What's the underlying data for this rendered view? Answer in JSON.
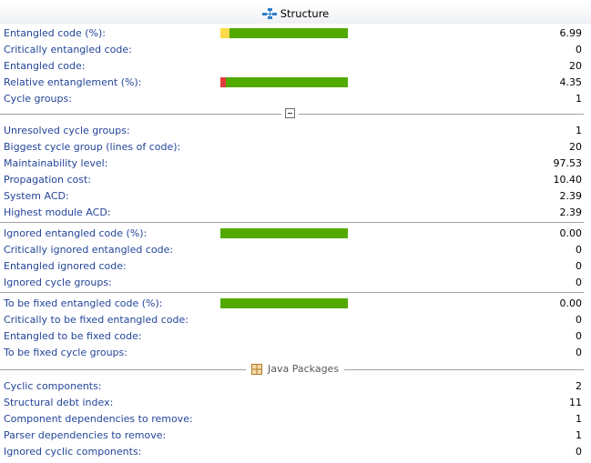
{
  "header": {
    "title": "Structure",
    "icon": "structure-icon"
  },
  "section2": {
    "title": "Java Packages",
    "icon": "java-packages-icon"
  },
  "colors": {
    "bar_green": "#52a900",
    "bar_yellow": "#fdd94c",
    "bar_red": "#e33b3b",
    "label": "#23459a"
  },
  "group1": [
    {
      "label": "Entangled code (%):",
      "value": "6.99",
      "bar": true,
      "seg_color": "#fdd94c",
      "seg_fraction": 0.07
    },
    {
      "label": "Critically entangled code:",
      "value": "0"
    },
    {
      "label": "Entangled code:",
      "value": "20"
    },
    {
      "label": "Relative entanglement (%):",
      "value": "4.35",
      "bar": true,
      "seg_color": "#e33b3b",
      "seg_fraction": 0.0435
    },
    {
      "label": "Cycle groups:",
      "value": "1"
    }
  ],
  "group2": [
    {
      "label": "Unresolved cycle groups:",
      "value": "1"
    },
    {
      "label": "Biggest cycle group (lines of code):",
      "value": "20"
    },
    {
      "label": "Maintainability level:",
      "value": "97.53"
    },
    {
      "label": "Propagation cost:",
      "value": "10.40"
    },
    {
      "label": "System ACD:",
      "value": "2.39"
    },
    {
      "label": "Highest module ACD:",
      "value": "2.39"
    }
  ],
  "group3": [
    {
      "label": "Ignored entangled code (%):",
      "value": "0.00",
      "bar": true
    },
    {
      "label": "Critically ignored entangled code:",
      "value": "0"
    },
    {
      "label": "Entangled ignored code:",
      "value": "0"
    },
    {
      "label": "Ignored cycle groups:",
      "value": "0"
    }
  ],
  "group4": [
    {
      "label": "To be fixed entangled code (%):",
      "value": "0.00",
      "bar": true
    },
    {
      "label": "Critically to be fixed entangled code:",
      "value": "0"
    },
    {
      "label": "Entangled to be fixed code:",
      "value": "0"
    },
    {
      "label": "To be fixed cycle groups:",
      "value": "0"
    }
  ],
  "group5": [
    {
      "label": "Cyclic components:",
      "value": "2"
    },
    {
      "label": "Structural debt index:",
      "value": "11"
    },
    {
      "label": "Component dependencies to remove:",
      "value": "1"
    },
    {
      "label": "Parser dependencies to remove:",
      "value": "1"
    },
    {
      "label": "Ignored cyclic components:",
      "value": "0"
    }
  ]
}
